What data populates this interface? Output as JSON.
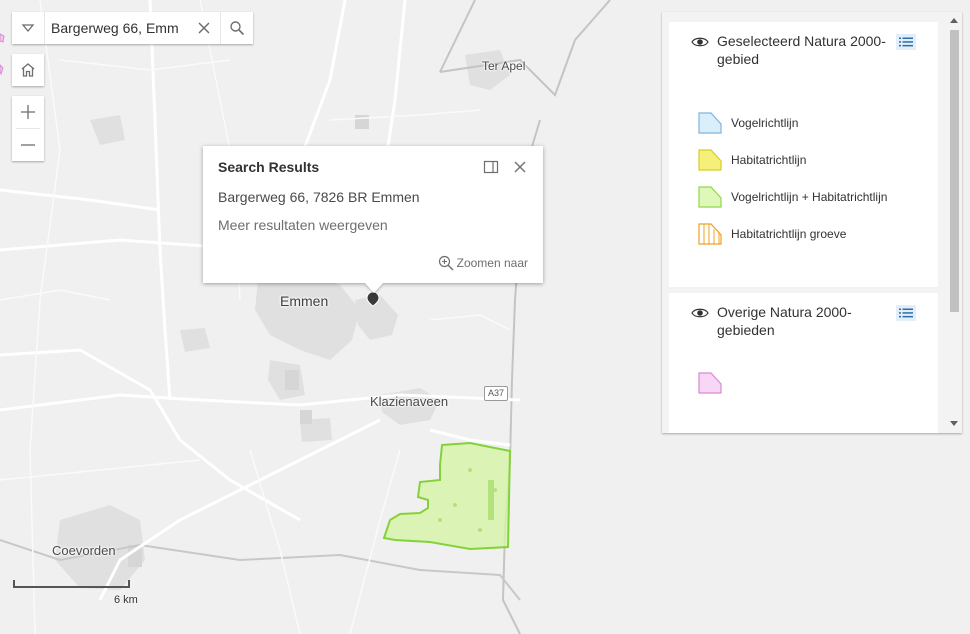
{
  "search": {
    "value": "Bargerweg 66, Emm",
    "dropdown_icon": "chevron-down-icon",
    "clear_icon": "close-icon",
    "search_icon": "search-icon"
  },
  "nav": {
    "home_icon": "home-icon",
    "zoom_in_icon": "plus-icon",
    "zoom_out_icon": "minus-icon"
  },
  "popup": {
    "title": "Search Results",
    "address": "Bargerweg 66, 7826 BR Emmen",
    "more_link": "Meer resultaten weergeven",
    "zoom_label": "Zoomen naar",
    "dock_icon": "dock-icon",
    "close_icon": "close-icon"
  },
  "legend": {
    "layers": [
      {
        "title": "Geselecteerd Natura 2000-gebied",
        "items": [
          {
            "label": "Vogelrichtlijn",
            "fill": "#dbeefb",
            "stroke": "#7fb4e0"
          },
          {
            "label": "Habitatrichtlijn",
            "fill": "#f5f07a",
            "stroke": "#d8cc2a"
          },
          {
            "label": "Vogelrichtlijn + Habitatrichtlijn",
            "fill": "#dff7b8",
            "stroke": "#8fd84a"
          },
          {
            "label": "Habitatrichtlijn groeve",
            "fill": "#ffffff",
            "stroke": "#f0a020"
          }
        ]
      },
      {
        "title": "Overige Natura 2000-gebieden",
        "items": [
          {
            "label": "",
            "fill": "#f7d7f5",
            "stroke": "#d98ad4"
          }
        ]
      }
    ]
  },
  "map": {
    "places": [
      "Ter Apel",
      "Emmen",
      "Klazienaveen",
      "Coevorden"
    ],
    "road_shield": "A37",
    "scale_label": "6 km",
    "natura_area_color": "#d7f4a8",
    "natura_area_stroke": "#84d23a",
    "marker_icon": "location-pin-icon"
  }
}
